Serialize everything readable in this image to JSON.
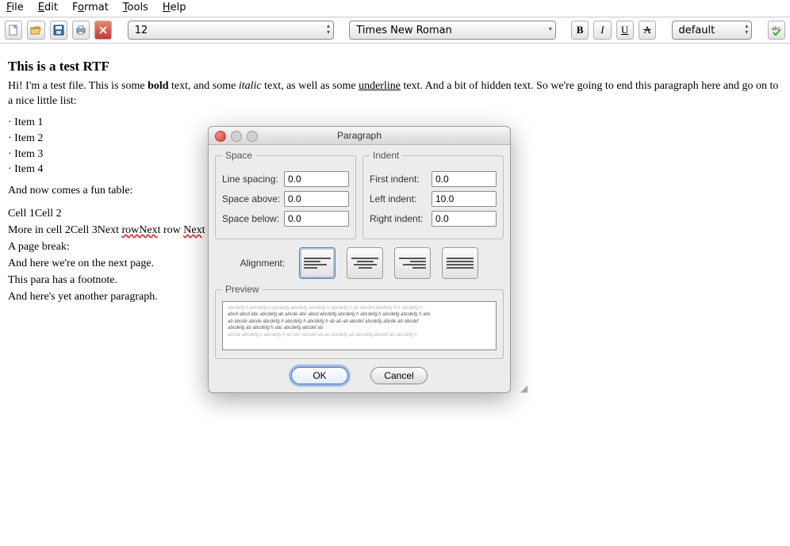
{
  "menu": {
    "file": "File",
    "edit": "Edit",
    "format": "Format",
    "tools": "Tools",
    "help": "Help",
    "file_u": "F",
    "edit_u": "E",
    "format_u": "o",
    "tools_u": "T",
    "help_u": "H"
  },
  "toolbar": {
    "font_size": "12",
    "font_family": "Times New Roman",
    "style": "default",
    "bold": "B",
    "italic": "I",
    "underline": "U",
    "abc": "A"
  },
  "document": {
    "heading": "This is a test RTF",
    "intro_1": "Hi! I'm a test file. This is some ",
    "intro_bold": "bold",
    "intro_2": " text, and some ",
    "intro_italic": "italic",
    "intro_3": " text, as well as some ",
    "intro_under": "underline",
    "intro_4": " text. And a bit of hidden text. So we're going to end this paragraph here and go on to a nice little list:",
    "items": [
      "Item 1",
      "Item 2",
      "Item 3",
      "Item 4"
    ],
    "table_intro": "And now comes a fun table:",
    "row1": "Cell 1Cell 2",
    "row2_a": "More in cell 2Cell 3Next ",
    "row2_w1": "rowNex",
    "row2_b": "t row ",
    "row2_w2": "Nex",
    "row2_c": "t row",
    "p_break": "A page break:",
    "p_next": "And here we're on the next page.",
    "p_foot": "This para has a footnote.",
    "p_last": "And here's yet another paragraph."
  },
  "dialog": {
    "title": "Paragraph",
    "space_legend": "Space",
    "indent_legend": "Indent",
    "line_spacing_label": "Line spacing:",
    "space_above_label": "Space above:",
    "space_below_label": "Space below:",
    "first_indent_label": "First indent:",
    "left_indent_label": "Left indent:",
    "right_indent_label": "Right indent:",
    "line_spacing": "0.0",
    "space_above": "0.0",
    "space_below": "0.0",
    "first_indent": "0.0",
    "left_indent": "10.0",
    "right_indent": "0.0",
    "alignment_label": "Alignment:",
    "preview_legend": "Preview",
    "ok": "OK",
    "cancel": "Cancel"
  }
}
